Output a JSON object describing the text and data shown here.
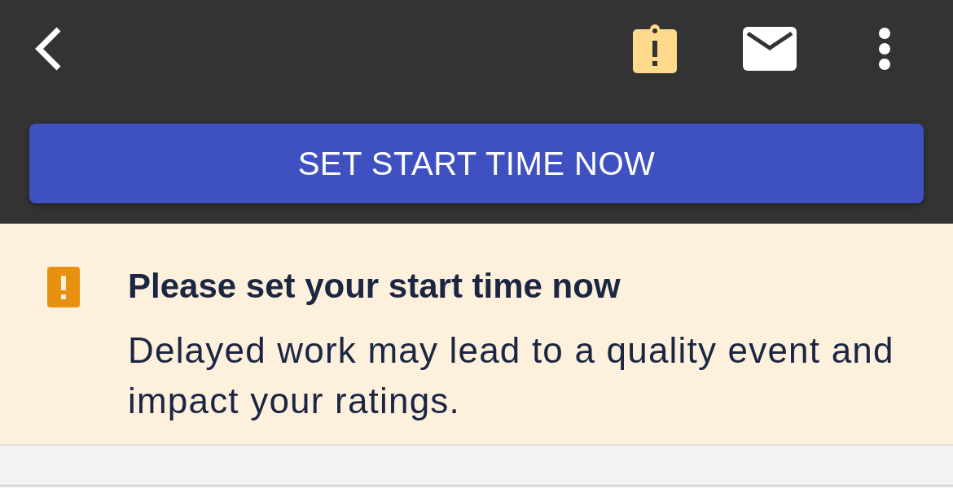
{
  "action_button": {
    "label": "SET START TIME NOW"
  },
  "alert": {
    "kind": "warning",
    "title": "Please set your start time now",
    "message": "Delayed work may lead to a quality event and impact your ratings."
  }
}
